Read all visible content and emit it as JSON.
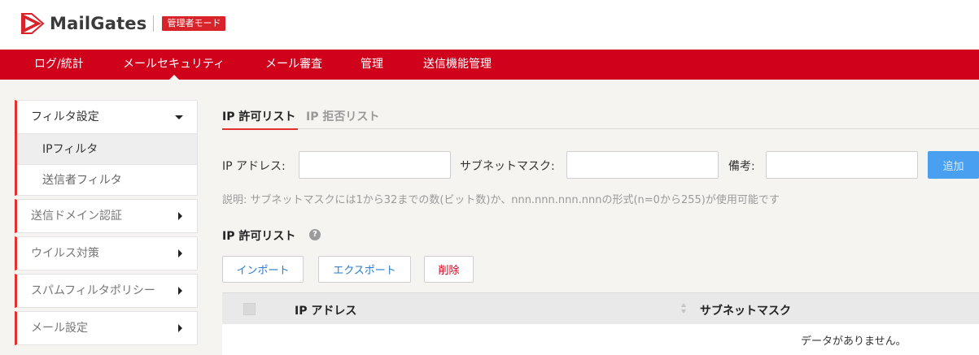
{
  "header": {
    "brand": "MailGates",
    "mode_badge": "管理者モード",
    "logo_icon": "mailgates-envelope-logo"
  },
  "nav": {
    "items": [
      {
        "label": "ログ/統計"
      },
      {
        "label": "メールセキュリティ",
        "active": true
      },
      {
        "label": "メール審査"
      },
      {
        "label": "管理"
      },
      {
        "label": "送信機能管理"
      }
    ]
  },
  "sidebar": {
    "groups": [
      {
        "label": "フィルタ設定",
        "expanded": true,
        "icon": "caret-down-icon",
        "children": [
          {
            "label": "IPフィルタ",
            "active": true
          },
          {
            "label": "送信者フィルタ"
          }
        ]
      },
      {
        "label": "送信ドメイン認証",
        "icon": "caret-right-icon"
      },
      {
        "label": "ウイルス対策",
        "icon": "caret-right-icon"
      },
      {
        "label": "スパムフィルタポリシー",
        "icon": "caret-right-icon"
      },
      {
        "label": "メール設定",
        "icon": "caret-right-icon"
      }
    ]
  },
  "tabs": [
    {
      "label": "IP 許可リスト",
      "active": true
    },
    {
      "label": "IP 拒否リスト",
      "active": false
    }
  ],
  "form": {
    "ip_label": "IP アドレス:",
    "ip_value": "",
    "mask_label": "サブネットマスク:",
    "mask_value": "",
    "note_label": "備考:",
    "note_value": "",
    "add_button": "追加"
  },
  "description": "説明: サブネットマスクには1から32までの数(ビット数)か、nnn.nnn.nnn.nnnの形式(n=0から255)が使用可能です",
  "list": {
    "title": "IP 許可リスト",
    "help_icon": "question-circle-icon",
    "help_glyph": "?",
    "buttons": {
      "import": "インポート",
      "export": "エクスポート",
      "delete": "削除"
    },
    "columns": [
      "IP アドレス",
      "サブネットマスク"
    ],
    "empty_message": "データがありません。"
  },
  "colors": {
    "brand_red": "#d0011b",
    "accent_blue": "#4aa0f0"
  }
}
